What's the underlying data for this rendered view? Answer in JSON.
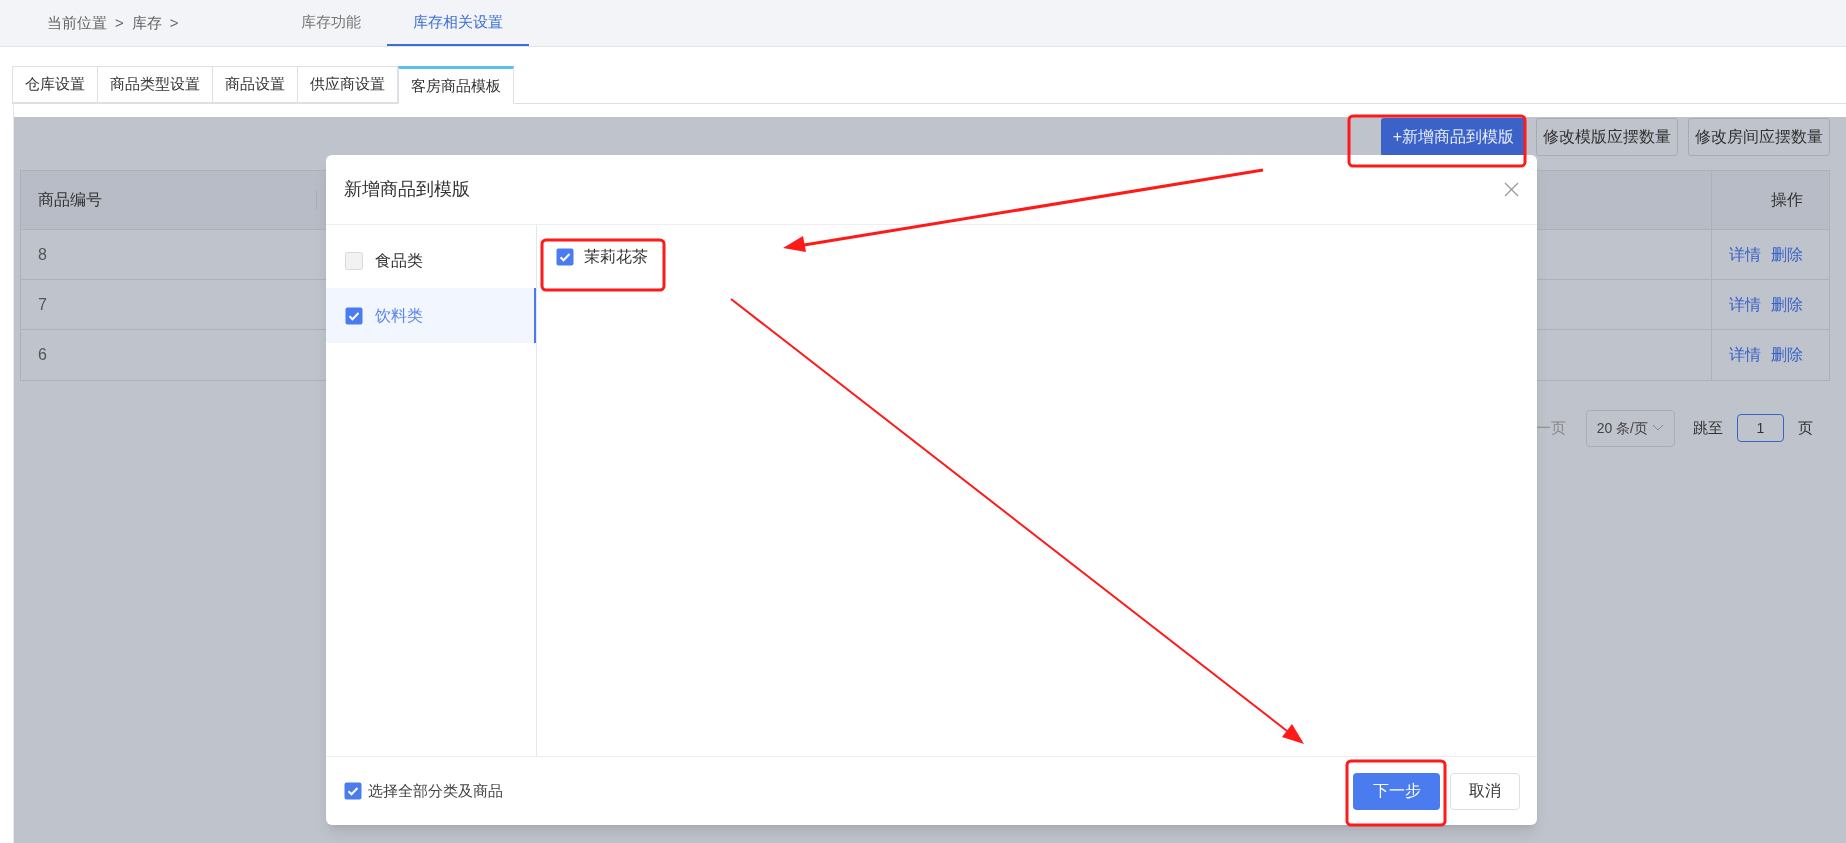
{
  "breadcrumb": [
    "当前位置",
    ">",
    "库存",
    ">"
  ],
  "top_tabs": [
    {
      "label": "库存功能",
      "selected": false
    },
    {
      "label": "库存相关设置",
      "selected": true
    }
  ],
  "sub_tabs": [
    {
      "label": "仓库设置",
      "selected": false
    },
    {
      "label": "商品类型设置",
      "selected": false
    },
    {
      "label": "商品设置",
      "selected": false
    },
    {
      "label": "供应商设置",
      "selected": false
    },
    {
      "label": "客房商品模板",
      "selected": true
    }
  ],
  "toolbar_buttons": [
    {
      "label": "+新增商品到模版",
      "kind": "primary"
    },
    {
      "label": "修改模版应摆数量",
      "kind": "default"
    },
    {
      "label": "修改房间应摆数量",
      "kind": "default"
    }
  ],
  "table": {
    "columns": [
      "商品编号",
      "操作"
    ],
    "rows": [
      {
        "cells": [
          "8"
        ],
        "actions": [
          "详情",
          "删除"
        ]
      },
      {
        "cells": [
          "7"
        ],
        "actions": [
          "详情",
          "删除"
        ]
      },
      {
        "cells": [
          "6"
        ],
        "actions": [
          "详情",
          "删除"
        ]
      }
    ]
  },
  "pagination": {
    "prev_fragment": "一页",
    "page_size": "20 条/页",
    "jump_label": "跳至",
    "page_value": "1",
    "page_suffix": "页"
  },
  "dialog": {
    "title": "新增商品到模版",
    "categories": [
      {
        "label": "食品类",
        "checked": false,
        "selected": false
      },
      {
        "label": "饮料类",
        "checked": true,
        "selected": true
      }
    ],
    "products": [
      {
        "label": "茉莉花茶",
        "checked": true
      }
    ],
    "select_all": {
      "label": "选择全部分类及商品",
      "checked": true
    },
    "buttons": [
      {
        "label": "下一步",
        "kind": "primary"
      },
      {
        "label": "取消",
        "kind": "default"
      }
    ]
  }
}
